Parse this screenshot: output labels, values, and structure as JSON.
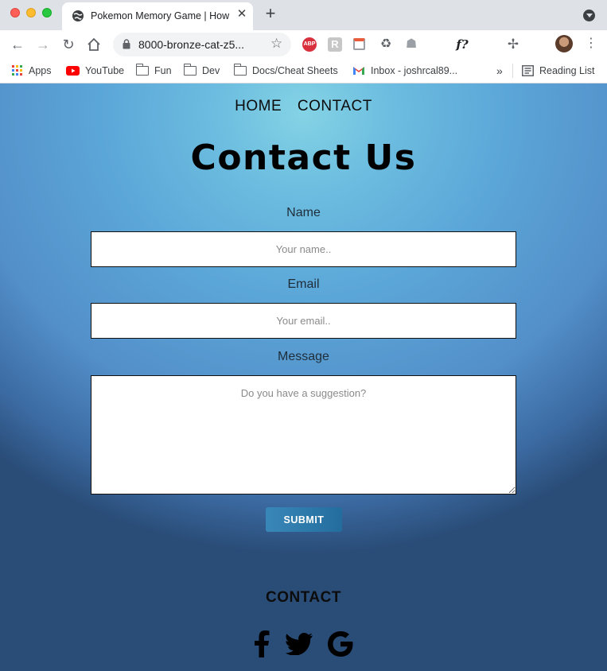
{
  "browser": {
    "tab_title": "Pokemon Memory Game | How",
    "url": "8000-bronze-cat-z5...",
    "bookmarks": [
      {
        "label": "Apps"
      },
      {
        "label": "YouTube"
      },
      {
        "label": "Fun"
      },
      {
        "label": "Dev"
      },
      {
        "label": "Docs/Cheat Sheets"
      },
      {
        "label": "Inbox - joshrcal89..."
      }
    ],
    "bookmarks_overflow": "»",
    "reading_list": "Reading List",
    "extension_badges": {
      "ghost": "0",
      "stack": "3"
    },
    "ext_fx": "f?"
  },
  "nav": {
    "home": "HOME",
    "contact": "CONTACT"
  },
  "page_title": "Contact Us",
  "form": {
    "name_label": "Name",
    "name_placeholder": "Your name..",
    "email_label": "Email",
    "email_placeholder": "Your email..",
    "message_label": "Message",
    "message_placeholder": "Do you have a suggestion?",
    "submit_label": "SUBMIT"
  },
  "footer": {
    "heading": "CONTACT",
    "social": [
      "facebook-icon",
      "twitter-icon",
      "google-icon"
    ]
  },
  "colors": {
    "submit_bg": "#2a78a8",
    "page_glow": "#84d3e5"
  }
}
